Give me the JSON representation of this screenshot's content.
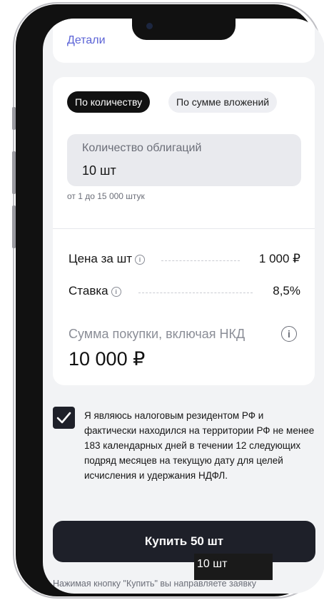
{
  "header": {
    "details_link": "Детали"
  },
  "mode": {
    "active": "По количеству",
    "inactive": "По сумме вложений"
  },
  "quantity": {
    "label": "Количество облигаций",
    "value": "10 шт",
    "hint": "от 1 до 15 000 штук"
  },
  "summary": {
    "price_label": "Цена за шт",
    "price_value": "1 000 ₽",
    "rate_label": "Ставка",
    "rate_value": "8,5%",
    "total_label": "Сумма покупки, включая НКД",
    "total_value": "10 000 ₽"
  },
  "consent": {
    "checked": true,
    "text": "Я являюсь налоговым резидентом РФ и фактически находился на территории РФ не менее 183 календарных дней в течении 12 следующих подряд месяцев на текущую дату для целей исчисления и удержания НДФЛ."
  },
  "buy_button": {
    "label": "Купить 50 шт"
  },
  "tooltip": {
    "text": "10 шт"
  },
  "disclaimer": {
    "text": "Нажимая кнопку \"Купить\" вы направляете заявку"
  },
  "icons": {
    "info": "info-icon",
    "check": "check-icon"
  },
  "colors": {
    "accent_link": "#5b63d6",
    "button_bg": "#1e2029",
    "screen_bg": "#f2f3f5"
  }
}
